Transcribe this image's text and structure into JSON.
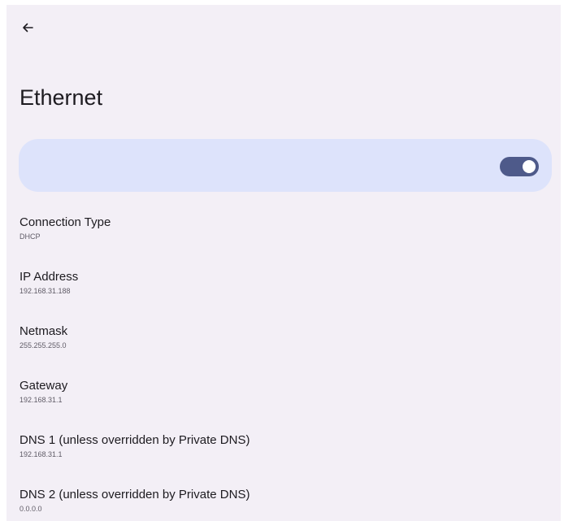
{
  "header": {
    "back_icon": "arrow-left-icon",
    "title": "Ethernet"
  },
  "toggle": {
    "state": "on",
    "track_color": "#4e5a8a",
    "card_color": "#dde3fb"
  },
  "items": [
    {
      "label": "Connection Type",
      "value": "DHCP"
    },
    {
      "label": "IP Address",
      "value": "192.168.31.188"
    },
    {
      "label": "Netmask",
      "value": "255.255.255.0"
    },
    {
      "label": "Gateway",
      "value": "192.168.31.1"
    },
    {
      "label": "DNS 1 (unless overridden by Private DNS)",
      "value": "192.168.31.1"
    },
    {
      "label": "DNS 2 (unless overridden by Private DNS)",
      "value": "0.0.0.0"
    }
  ]
}
